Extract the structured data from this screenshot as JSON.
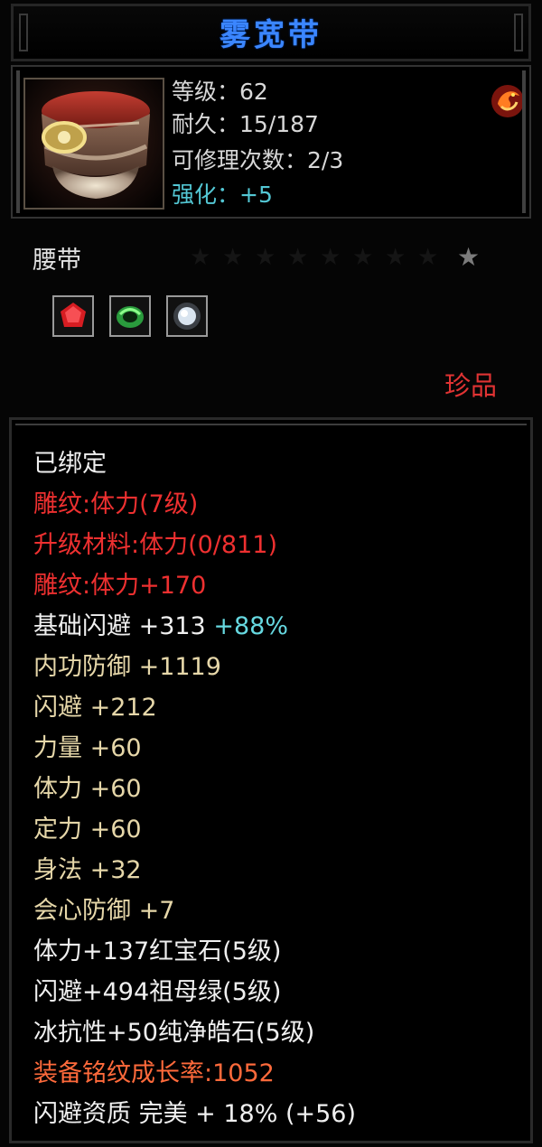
{
  "title": "雾宽带",
  "level": "等级：62",
  "durability": "耐久：15/187",
  "repair": "可修理次数：2/3",
  "enhance": "强化：+5",
  "item_type": "腰带",
  "rarity": "珍品",
  "stars_total": 9,
  "stars_filled": 1,
  "colors": {
    "title": "#3b86ff",
    "red": "#ee3030",
    "gold": "#e6d7a9",
    "cyan": "#66d8e0",
    "orange": "#ff6a3b"
  },
  "gems": [
    "ruby-gem-icon",
    "emerald-gem-icon",
    "diamond-gem-icon"
  ],
  "lines": [
    {
      "text": "已绑定",
      "color": "white"
    },
    {
      "text": "雕纹:体力(7级)",
      "color": "red"
    },
    {
      "text": "升级材料:体力(0/811)",
      "color": "red"
    },
    {
      "text": "雕纹:体力+170",
      "color": "red"
    },
    {
      "text": "基础闪避  +313",
      "extra": "+88%",
      "color": "white"
    },
    {
      "text": "内功防御  +1119",
      "color": "gold"
    },
    {
      "text": "闪避  +212",
      "color": "gold"
    },
    {
      "text": "力量  +60",
      "color": "gold"
    },
    {
      "text": "体力  +60",
      "color": "gold"
    },
    {
      "text": "定力  +60",
      "color": "gold"
    },
    {
      "text": "身法  +32",
      "color": "gold"
    },
    {
      "text": "会心防御  +7",
      "color": "gold"
    },
    {
      "text": "体力+137红宝石(5级)",
      "color": "white"
    },
    {
      "text": "闪避+494祖母绿(5级)",
      "color": "white"
    },
    {
      "text": "冰抗性+50纯净皓石(5级)",
      "color": "white"
    },
    {
      "text": "装备铭纹成长率:1052",
      "color": "orange"
    },
    {
      "text": "闪避资质  完美  +  18%  (+56)",
      "color": "white"
    }
  ]
}
